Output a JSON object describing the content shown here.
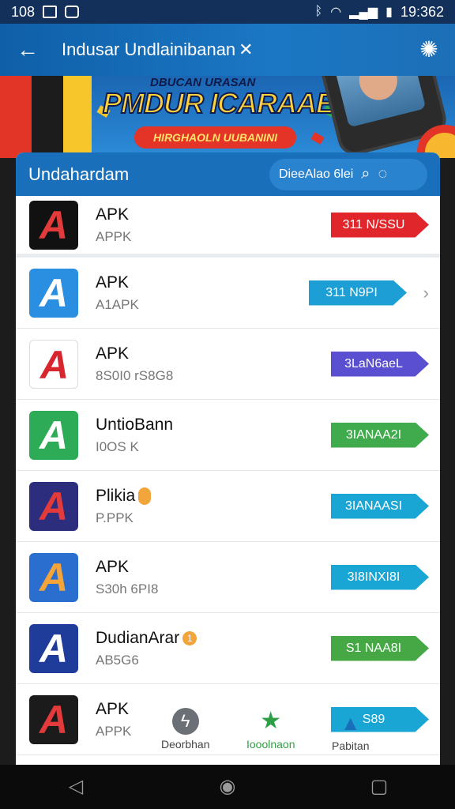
{
  "status_bar": {
    "left_text": "108",
    "time": "19:362",
    "icons": [
      "gallery-icon",
      "message-icon",
      "bluetooth-icon",
      "wifi-icon",
      "signal-icon",
      "battery-icon"
    ]
  },
  "app_bar": {
    "title": "Indusar Undlainibanan",
    "title_suffix": "✕",
    "back_icon": "arrow-left-icon",
    "settings_icon": "gear-icon"
  },
  "banner": {
    "small_text": "DBUCAN URASAN",
    "headline": "PMDUR ICARAAE !",
    "ribbon_text": "HIRGHAOLN UUBANINI"
  },
  "card": {
    "title": "Undahardam",
    "search_text": "DieeAlao 6lei",
    "search_icon": "search-icon",
    "chat_icon": "chat-icon"
  },
  "apps": [
    {
      "name": "APK",
      "sub": "APPK",
      "action": "311 N/SSU",
      "action_color": "#e0262b",
      "icon_bg": "#111111",
      "icon_fg": "#e33b3b"
    },
    {
      "name": "APK",
      "sub": "A1APK",
      "action": "311 N9PI",
      "action_color": "#1d9fd6",
      "icon_bg": "#2a8fe0",
      "icon_fg": "#ffffff"
    },
    {
      "name": "APK",
      "sub": "8S0I0 rS8G8",
      "action": "3LaN6aeL",
      "action_color": "#5a4fd1",
      "icon_bg": "#ffffff",
      "icon_fg": "#d8262e"
    },
    {
      "name": "UntioBann",
      "sub": "I0OS K",
      "action": "3IANAA2I",
      "action_color": "#3fab4c",
      "icon_bg": "#2eab57",
      "icon_fg": "#ffffff"
    },
    {
      "name": "Plikia",
      "sub": "P.PPK",
      "action": "3IANAASI",
      "action_color": "#1aa6d4",
      "icon_bg": "#2c2d7d",
      "icon_fg": "#e33b3b"
    },
    {
      "name": "APK",
      "sub": "S30h 6PI8",
      "action": "3I8INXI8I",
      "action_color": "#1aa6d4",
      "icon_bg": "#2a6fd0",
      "icon_fg": "#f5a43a"
    },
    {
      "name": "DudianArar",
      "sub": "AB5G6",
      "action": "S1 NAA8I",
      "action_color": "#45a844",
      "icon_bg": "#1f3c9a",
      "icon_fg": "#ffffff"
    },
    {
      "name": "APK",
      "sub": "APPK",
      "action": "S89",
      "action_color": "#1aa6d4",
      "icon_bg": "#1b1b1b",
      "icon_fg": "#e33b3b"
    }
  ],
  "bottom_nav": [
    {
      "label": "Deorbhan",
      "icon": "messenger-icon"
    },
    {
      "label": "Iooolnaon",
      "icon": "star-icon"
    },
    {
      "label": "Pabitan",
      "icon": "app-store-icon"
    }
  ],
  "system_nav": [
    "back-triangle-icon",
    "home-circle-icon",
    "recents-square-icon"
  ]
}
